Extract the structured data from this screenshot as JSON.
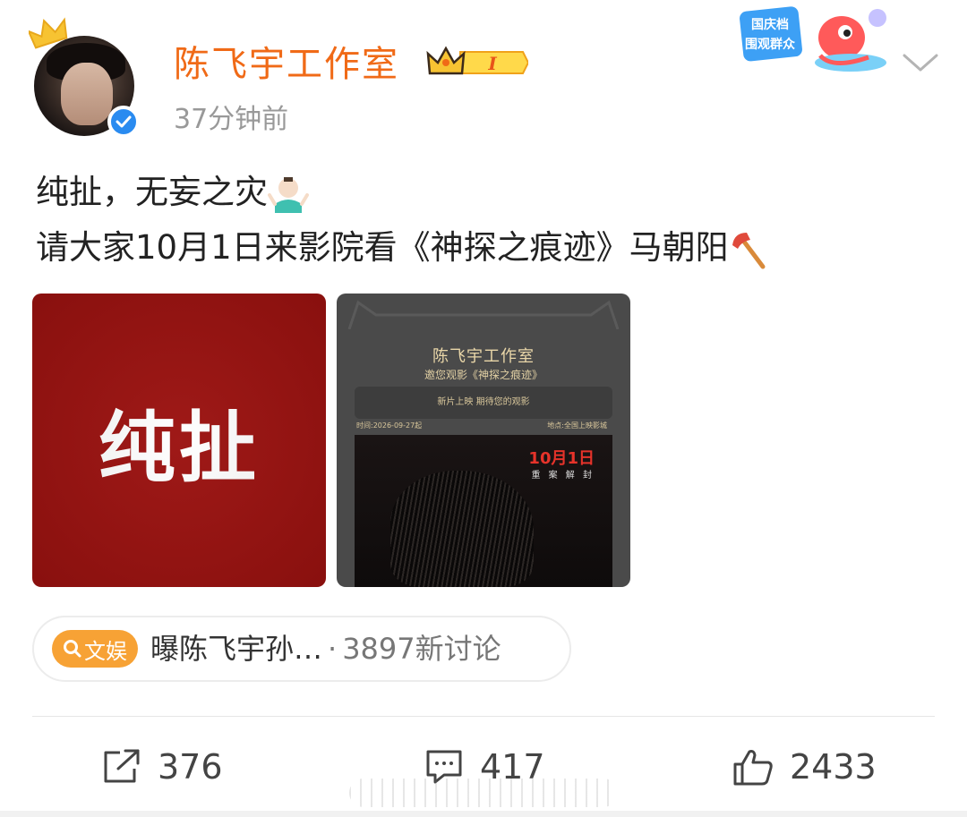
{
  "header": {
    "username": "陈飞宇工作室",
    "timestamp": "37分钟前",
    "vip_level": "I",
    "festival_badge_line1": "国庆档",
    "festival_badge_line2": "围观群众",
    "avatar_icon": "avatar-portrait",
    "verified_icon": "verified-check-icon",
    "menu_icon": "chevron-down-icon"
  },
  "post": {
    "line1": "纯扯，无妄之灾",
    "line2": "请大家10月1日来影院看《神探之痕迹》马朝阳",
    "emoji1": "shrug-emoji",
    "emoji2": "axe-emoji"
  },
  "images": {
    "image1_text": "纯扯",
    "image2": {
      "studio": "陈飞宇工作室",
      "invite": "邀您观影《神探之痕迹》",
      "slogan": "新片上映  期待您的观影",
      "time": "时间:2026-09-27起",
      "place": "地点:全国上映影城",
      "date": "10月1日",
      "case": "重 案 解 封"
    }
  },
  "topic": {
    "tag": "文娱",
    "title": "曝陈飞宇孙…",
    "separator": "·",
    "count": "3897新讨论"
  },
  "actions": {
    "share_count": "376",
    "comment_count": "417",
    "like_count": "2433"
  },
  "colors": {
    "username": "#f06a17",
    "tag_bg": "#f7a235",
    "verified": "#2a8bf0",
    "image1_bg": "#9c1210"
  }
}
